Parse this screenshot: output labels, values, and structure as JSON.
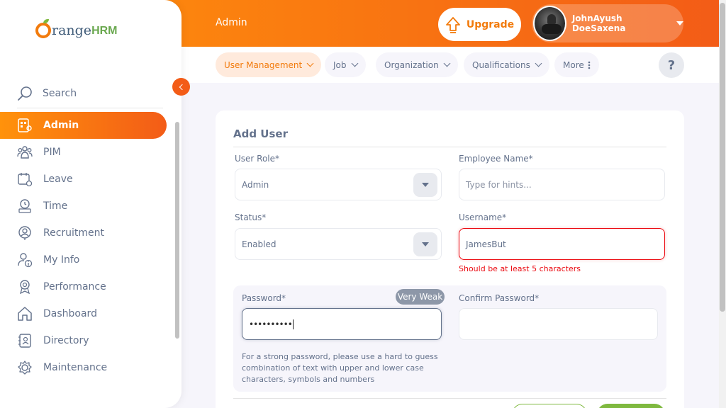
{
  "header": {
    "module_title": "Admin",
    "upgrade_label": "Upgrade",
    "user_name": "JohnAyush DoeSaxena",
    "help_label": "?"
  },
  "logo": {
    "text_a": "range",
    "text_b": "HRM"
  },
  "sidebar": {
    "search_label": "Search",
    "items": [
      {
        "label": "Admin",
        "icon": "admin-icon",
        "active": true
      },
      {
        "label": "PIM",
        "icon": "pim-icon"
      },
      {
        "label": "Leave",
        "icon": "leave-icon"
      },
      {
        "label": "Time",
        "icon": "time-icon"
      },
      {
        "label": "Recruitment",
        "icon": "recruitment-icon"
      },
      {
        "label": "My Info",
        "icon": "my-info-icon"
      },
      {
        "label": "Performance",
        "icon": "performance-icon"
      },
      {
        "label": "Dashboard",
        "icon": "dashboard-icon"
      },
      {
        "label": "Directory",
        "icon": "directory-icon"
      },
      {
        "label": "Maintenance",
        "icon": "maintenance-icon"
      }
    ]
  },
  "subnav": {
    "tabs": [
      {
        "label": "User Management",
        "active": true
      },
      {
        "label": "Job"
      },
      {
        "label": "Organization"
      },
      {
        "label": "Qualifications"
      },
      {
        "label": "More"
      }
    ]
  },
  "form": {
    "title": "Add User",
    "user_role": {
      "label": "User Role*",
      "value": "Admin"
    },
    "employee_name": {
      "label": "Employee Name*",
      "placeholder": "Type for hints..."
    },
    "status": {
      "label": "Status*",
      "value": "Enabled"
    },
    "username": {
      "label": "Username*",
      "value": "JamesBut",
      "error": "Should be at least 5 characters"
    },
    "password": {
      "label": "Password*",
      "masked_value": "••••••••••",
      "strength": "Very Weak",
      "hint": "For a strong password, please use a hard to guess combination of text with upper and lower case characters, symbols and numbers"
    },
    "confirm_password": {
      "label": "Confirm Password*",
      "value": ""
    }
  },
  "colors": {
    "brand_orange": "#f35c17",
    "brand_light": "#ff920b",
    "accent_green": "#7fb93f",
    "error_red": "#eb0910"
  }
}
